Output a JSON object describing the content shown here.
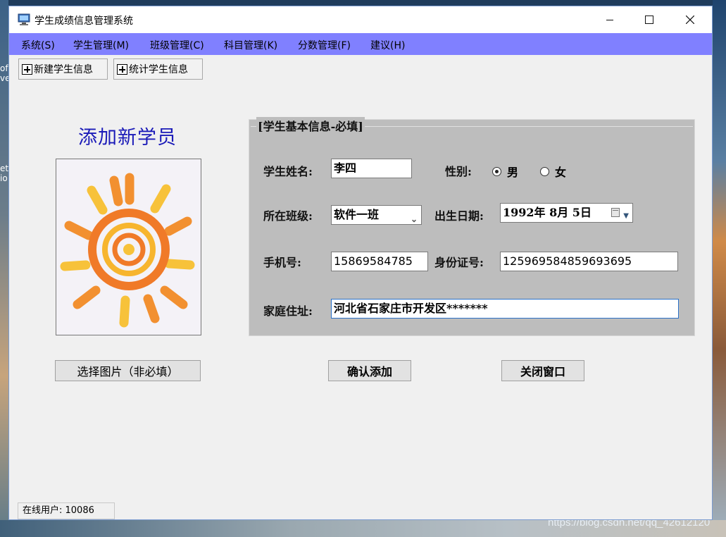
{
  "window": {
    "title": "学生成绩信息管理系统",
    "minimize_icon": "minimize-icon",
    "maximize_icon": "maximize-icon",
    "close_icon": "close-icon"
  },
  "menu": [
    "系统(S)",
    "学生管理(M)",
    "班级管理(C)",
    "科目管理(K)",
    "分数管理(F)",
    "建议(H)"
  ],
  "toolbar": {
    "new_student": "新建学生信息",
    "stats_student": "统计学生信息"
  },
  "headline": "添加新学员",
  "photo": {
    "icon": "sun-drawing"
  },
  "panel": {
    "title": "[学生基本信息-必填]",
    "name_label": "学生姓名:",
    "name_value": "李四",
    "gender_label": "性别:",
    "gender_male": "男",
    "gender_female": "女",
    "gender_selected": "男",
    "class_label": "所在班级:",
    "class_value": "软件一班",
    "birth_label": "出生日期:",
    "birth_value": "1992年 8月 5日",
    "phone_label": "手机号:",
    "phone_value": "15869584785",
    "id_label": "身份证号:",
    "id_value": "125969584859693695",
    "address_label": "家庭住址:",
    "address_value": "河北省石家庄市开发区*******"
  },
  "buttons": {
    "choose_image": "选择图片（非必填）",
    "confirm": "确认添加",
    "close": "关闭窗口"
  },
  "status": {
    "online_users": "在线用户: 10086"
  },
  "watermark": "https://blog.csdn.net/qq_42612120",
  "colors": {
    "menubar": "#8080ff",
    "headline": "#1a1ab8",
    "panel": "#bdbdbd"
  }
}
